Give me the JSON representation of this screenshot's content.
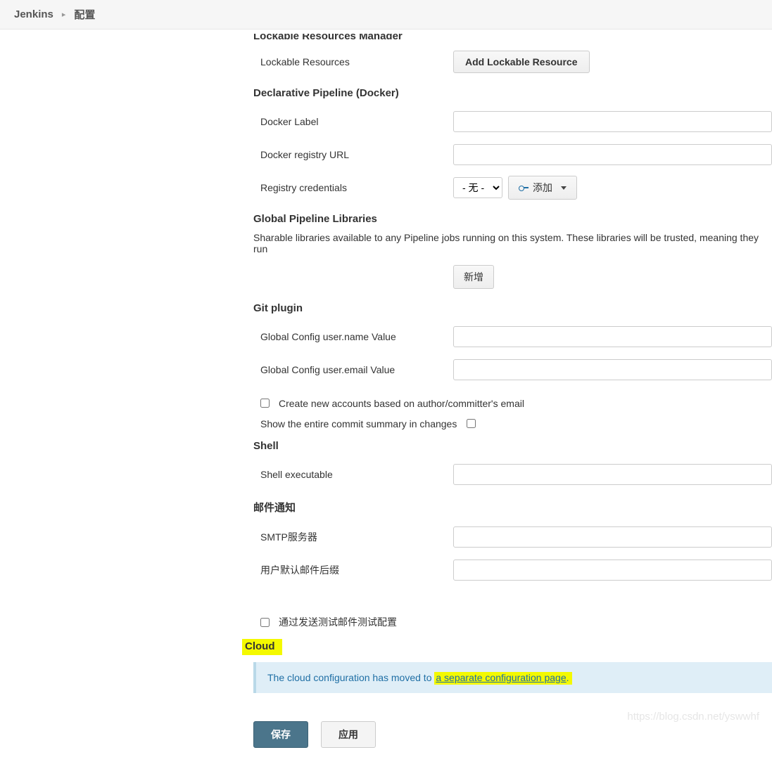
{
  "breadcrumb": {
    "root": "Jenkins",
    "current": "配置"
  },
  "sections": {
    "lockable": {
      "title": "Lockable Resources Manager",
      "resources_label": "Lockable Resources",
      "add_btn": "Add Lockable Resource"
    },
    "docker": {
      "title": "Declarative Pipeline (Docker)",
      "label_label": "Docker Label",
      "registry_url_label": "Docker registry URL",
      "registry_cred_label": "Registry credentials",
      "cred_select": "- 无 -",
      "add_btn": "添加"
    },
    "libraries": {
      "title": "Global Pipeline Libraries",
      "desc": "Sharable libraries available to any Pipeline jobs running on this system. These libraries will be trusted, meaning they run",
      "add_btn": "新增"
    },
    "git": {
      "title": "Git plugin",
      "user_name_label": "Global Config user.name Value",
      "user_email_label": "Global Config user.email Value",
      "create_accounts_label": "Create new accounts based on author/committer's email",
      "show_summary_label": "Show the entire commit summary in changes"
    },
    "shell": {
      "title": "Shell",
      "exec_label": "Shell executable"
    },
    "mail": {
      "title": "邮件通知",
      "smtp_label": "SMTP服务器",
      "suffix_label": "用户默认邮件后缀",
      "test_label": "通过发送测试邮件测试配置"
    },
    "cloud": {
      "title": "Cloud",
      "info_prefix": "The cloud configuration has moved to ",
      "info_link": "a separate configuration page",
      "info_suffix": "."
    }
  },
  "footer": {
    "save": "保存",
    "apply": "应用"
  },
  "watermark": "https://blog.csdn.net/yswwhf"
}
